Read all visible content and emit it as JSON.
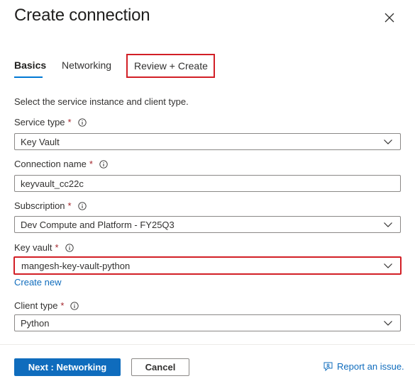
{
  "dialog": {
    "title": "Create connection"
  },
  "tabs": [
    {
      "label": "Basics",
      "active": true
    },
    {
      "label": "Networking",
      "active": false
    },
    {
      "label": "Review + Create",
      "active": false
    }
  ],
  "intro": "Select the service instance and client type.",
  "fields": {
    "service_type": {
      "label": "Service type",
      "required": "*",
      "value": "Key Vault"
    },
    "connection_name": {
      "label": "Connection name",
      "required": "*",
      "value": "keyvault_cc22c"
    },
    "subscription": {
      "label": "Subscription",
      "required": "*",
      "value": "Dev Compute and Platform - FY25Q3"
    },
    "key_vault": {
      "label": "Key vault",
      "required": "*",
      "value": "mangesh-key-vault-python",
      "create_new": "Create new"
    },
    "client_type": {
      "label": "Client type",
      "required": "*",
      "value": "Python"
    }
  },
  "footer": {
    "next_label": "Next : Networking",
    "cancel_label": "Cancel",
    "report_label": "Report an issue."
  },
  "colors": {
    "accent": "#0078d4",
    "primary_button": "#0f6cbd",
    "highlight_border": "#d21f26",
    "required": "#a4262c"
  },
  "icons": {
    "close": "close-icon",
    "info": "info-icon",
    "dropdown": "chevron-down-icon",
    "report": "feedback-icon"
  }
}
